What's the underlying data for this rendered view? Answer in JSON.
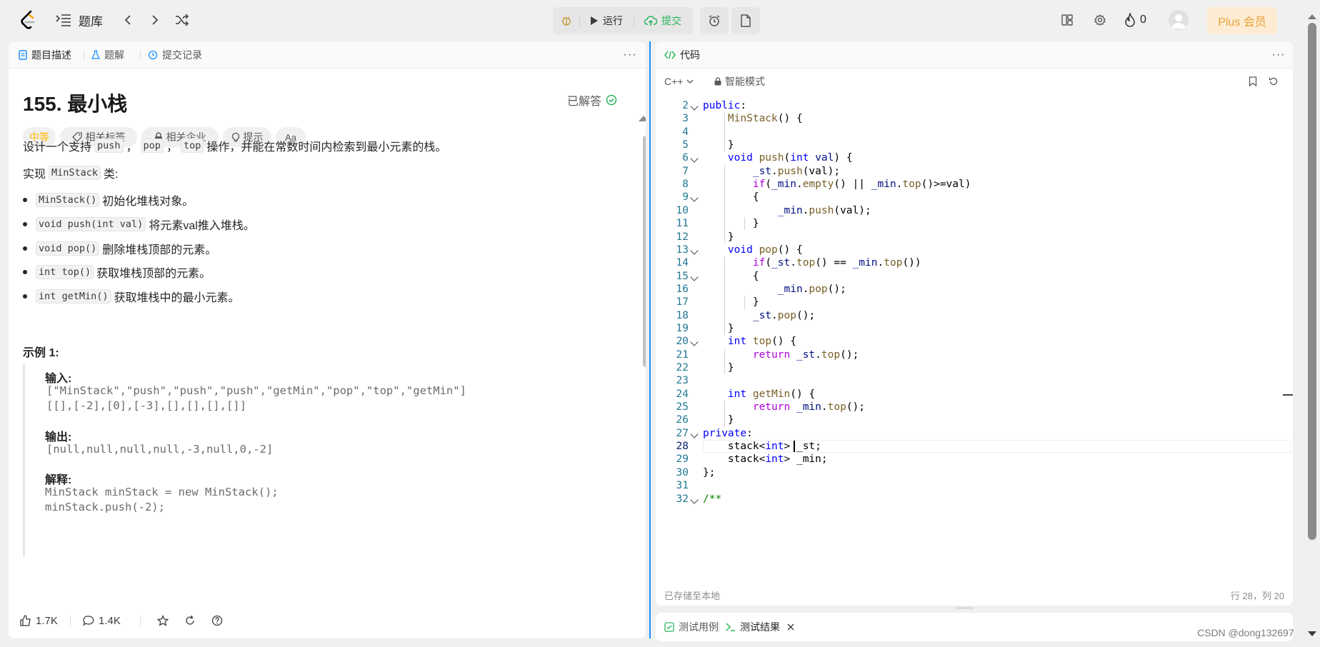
{
  "topbar": {
    "nav_label": "题库",
    "run_label": "运行",
    "submit_label": "提交",
    "streak_count": "0",
    "plus_label": "Plus 会员"
  },
  "left_panel": {
    "tabs": [
      {
        "label": "题目描述",
        "icon": "doc-icon"
      },
      {
        "label": "题解",
        "icon": "flask-icon"
      },
      {
        "label": "提交记录",
        "icon": "history-icon"
      }
    ],
    "title": "155. 最小栈",
    "solved_label": "已解答",
    "chips": {
      "difficulty": "中等",
      "tags": "相关标签",
      "companies": "相关企业",
      "hint": "提示",
      "lang": "Aa"
    },
    "desc": {
      "p1_a": "设计一个支持",
      "p1_push": "push",
      "p1_sep1": "，",
      "p1_pop": "pop",
      "p1_sep2": "，",
      "p1_top": "top",
      "p1_b": "操作，并能在常数时间内检索到最小元素的栈。",
      "p2_a": "实现",
      "p2_code": "MinStack",
      "p2_b": "类:"
    },
    "bullets": [
      {
        "code": "MinStack()",
        "text": "初始化堆栈对象。"
      },
      {
        "code": "void push(int val)",
        "text": "将元素val推入堆栈。"
      },
      {
        "code": "void pop()",
        "text": "删除堆栈顶部的元素。"
      },
      {
        "code": "int top()",
        "text": "获取堆栈顶部的元素。"
      },
      {
        "code": "int getMin()",
        "text": "获取堆栈中的最小元素。"
      }
    ],
    "example": {
      "title": "示例 1:",
      "input_label": "输入:",
      "input_line1": "[\"MinStack\",\"push\",\"push\",\"push\",\"getMin\",\"pop\",\"top\",\"getMin\"]",
      "input_line2": "[[],[-2],[0],[-3],[],[],[],[]]",
      "output_label": "输出:",
      "output_line": "[null,null,null,null,-3,null,0,-2]",
      "explain_label": "解释:",
      "explain_line1": "MinStack minStack = new MinStack();",
      "explain_line2": "minStack.push(-2);"
    },
    "footer": {
      "likes": "1.7K",
      "comments": "1.4K"
    }
  },
  "code_panel": {
    "tab_label": "代码",
    "language": "C++",
    "mode_label": "智能模式",
    "saved_status": "已存储至本地",
    "cursor_position": "行 28，列 20"
  },
  "test_panel": {
    "tab_cases": "测试用例",
    "tab_results": "测试结果"
  },
  "watermark": "CSDN @dong132697",
  "colors": {
    "accent_blue": "#1a90ff",
    "submit_green": "#2db55d",
    "difficulty_medium": "#ffb800",
    "plus_bg": "#fdecd3",
    "plus_text": "#e8a03a"
  }
}
